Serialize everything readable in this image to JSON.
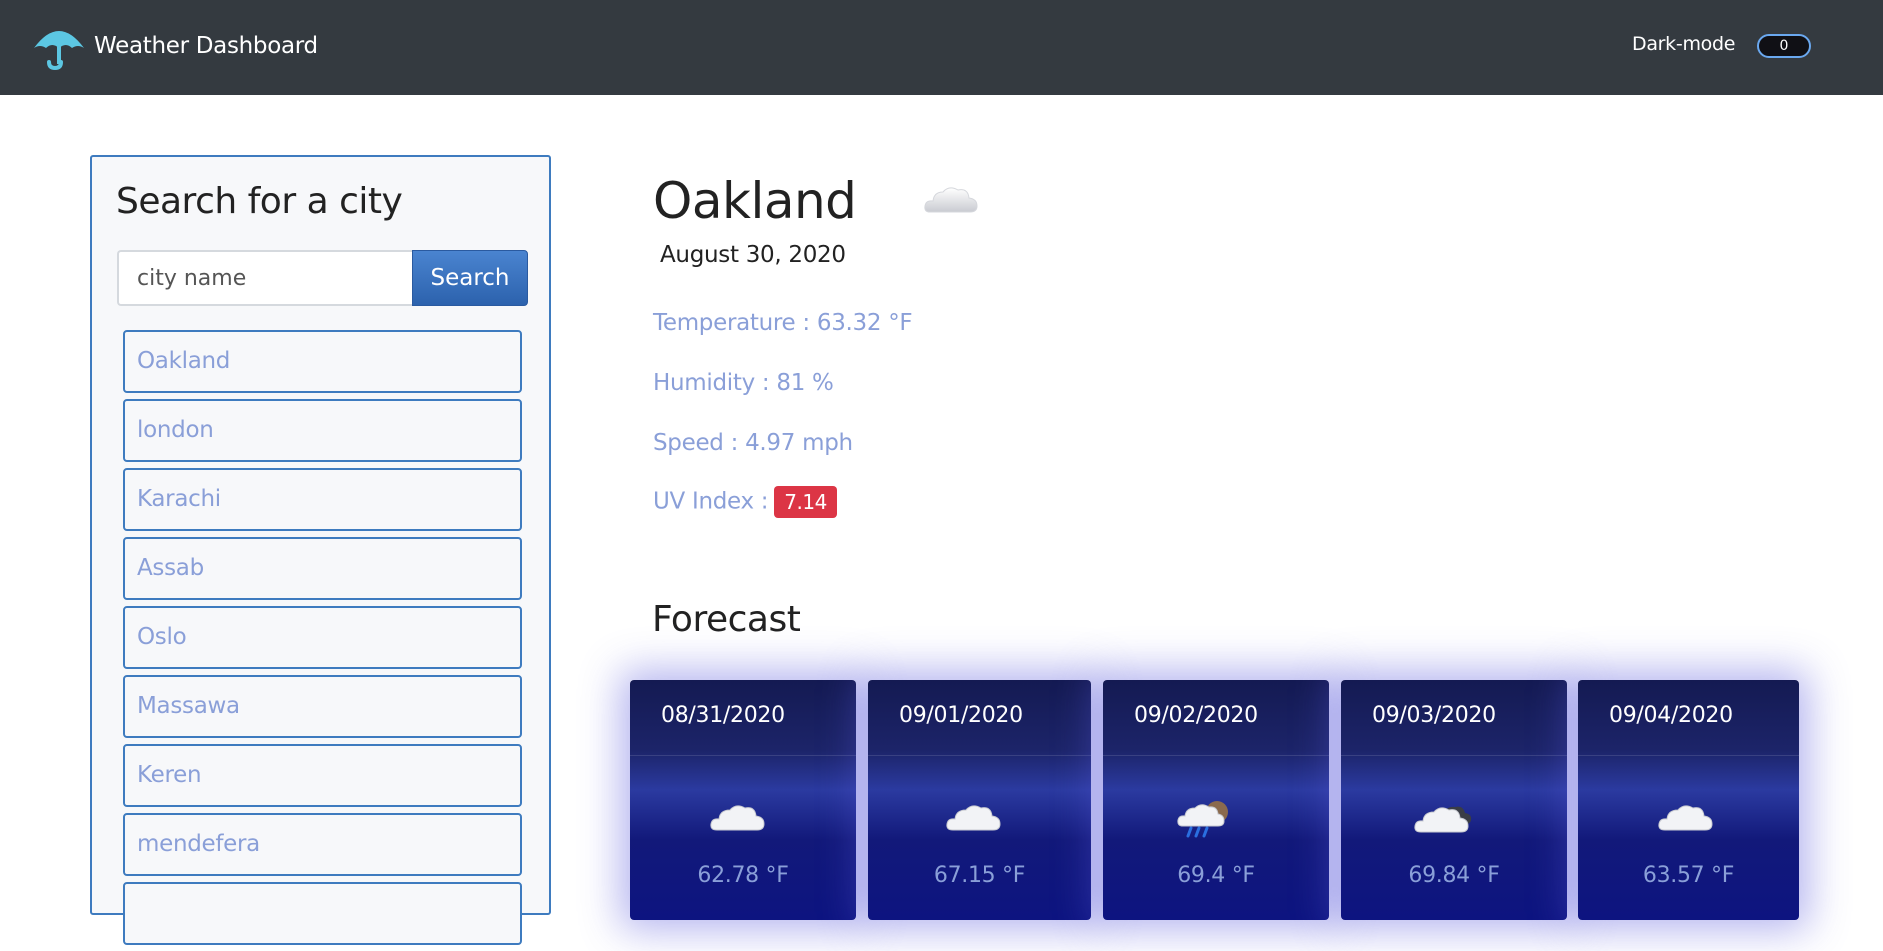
{
  "header": {
    "title": "Weather Dashboard",
    "icon": "umbrella-icon",
    "dark_mode_label": "Dark-mode",
    "dark_mode_value": "0"
  },
  "search": {
    "title": "Search for a city",
    "placeholder": "city name",
    "button_label": "Search",
    "history": [
      "Oakland",
      "london",
      "Karachi",
      "Assab",
      "Oslo",
      "Massawa",
      "Keren",
      "mendefera"
    ]
  },
  "current": {
    "city": "Oakland",
    "icon": "cloud-icon",
    "date": "August 30, 2020",
    "temperature": "Temperature : 63.32 °F",
    "humidity": "Humidity : 81 %",
    "speed": "Speed : 4.97 mph",
    "uv_label": "UV Index :",
    "uv_value": "7.14"
  },
  "forecast": {
    "title": "Forecast",
    "days": [
      {
        "date": "08/31/2020",
        "icon": "cloud-icon",
        "temp": "62.78 °F"
      },
      {
        "date": "09/01/2020",
        "icon": "cloud-icon",
        "temp": "67.15 °F"
      },
      {
        "date": "09/02/2020",
        "icon": "rain-cloud-icon",
        "temp": "69.4 °F"
      },
      {
        "date": "09/03/2020",
        "icon": "cloudy-icon",
        "temp": "69.84 °F"
      },
      {
        "date": "09/04/2020",
        "icon": "cloud-icon",
        "temp": "63.57 °F"
      }
    ]
  },
  "colors": {
    "navbar": "#343a40",
    "accent": "#3e7bbf",
    "muted_text": "#8a9fd8",
    "uv_badge": "#dc3545"
  }
}
